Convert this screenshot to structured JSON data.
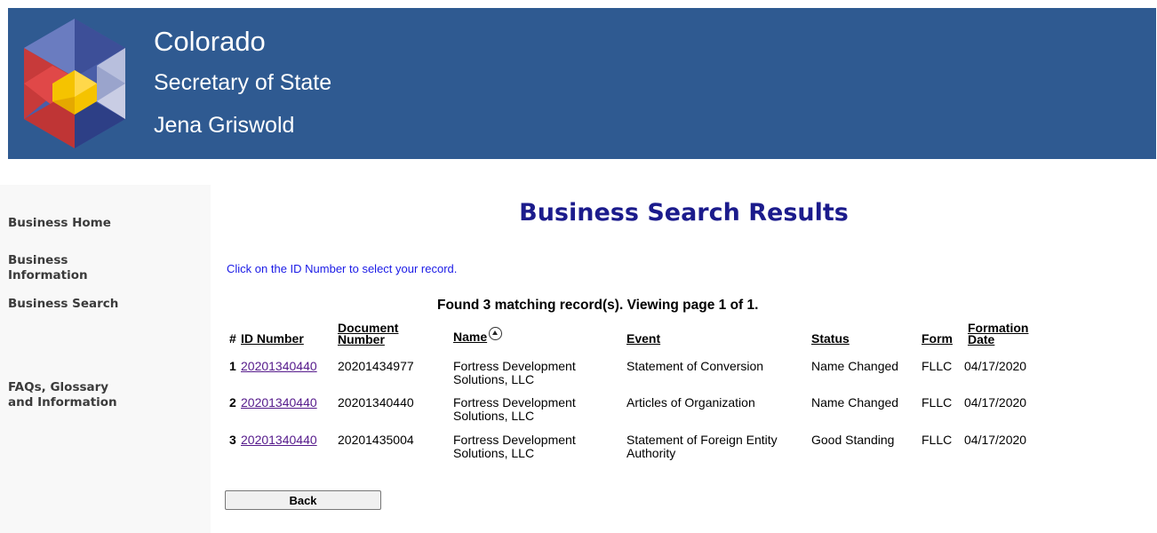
{
  "banner": {
    "line1": "Colorado",
    "line2": "Secretary of State",
    "line3": "Jena Griswold",
    "background": "#2f5a91"
  },
  "sidebar": {
    "items": [
      {
        "label": "Business Home"
      },
      {
        "label": "Business Information"
      },
      {
        "label": "Business Search"
      },
      {
        "label": "FAQs, Glossary and Information"
      }
    ]
  },
  "page": {
    "title": "Business Search Results",
    "instruction": "Click on the ID Number to select your record.",
    "found_text": "Found 3 matching record(s).  Viewing page 1 of 1."
  },
  "table": {
    "headers": {
      "num": "#",
      "id": "ID Number",
      "document": "Document Number",
      "name": "Name",
      "event": "Event",
      "status": "Status",
      "form": "Form",
      "formation": "Formation Date"
    },
    "sort_icon": "sort-ascending-icon",
    "rows": [
      {
        "num": "1",
        "id": "20201340440",
        "document": "20201434977",
        "name": "Fortress Development Solutions, LLC",
        "event": "Statement of Conversion",
        "status": "Name Changed",
        "form": "FLLC",
        "date": "04/17/2020"
      },
      {
        "num": "2",
        "id": "20201340440",
        "document": "20201340440",
        "name": "Fortress Development Solutions, LLC",
        "event": "Articles of Organization",
        "status": "Name Changed",
        "form": "FLLC",
        "date": "04/17/2020"
      },
      {
        "num": "3",
        "id": "20201340440",
        "document": "20201435004",
        "name": "Fortress Development Solutions, LLC",
        "event": "Statement of Foreign Entity Authority",
        "status": "Good Standing",
        "form": "FLLC",
        "date": "04/17/2020"
      }
    ]
  },
  "buttons": {
    "back": "Back"
  }
}
